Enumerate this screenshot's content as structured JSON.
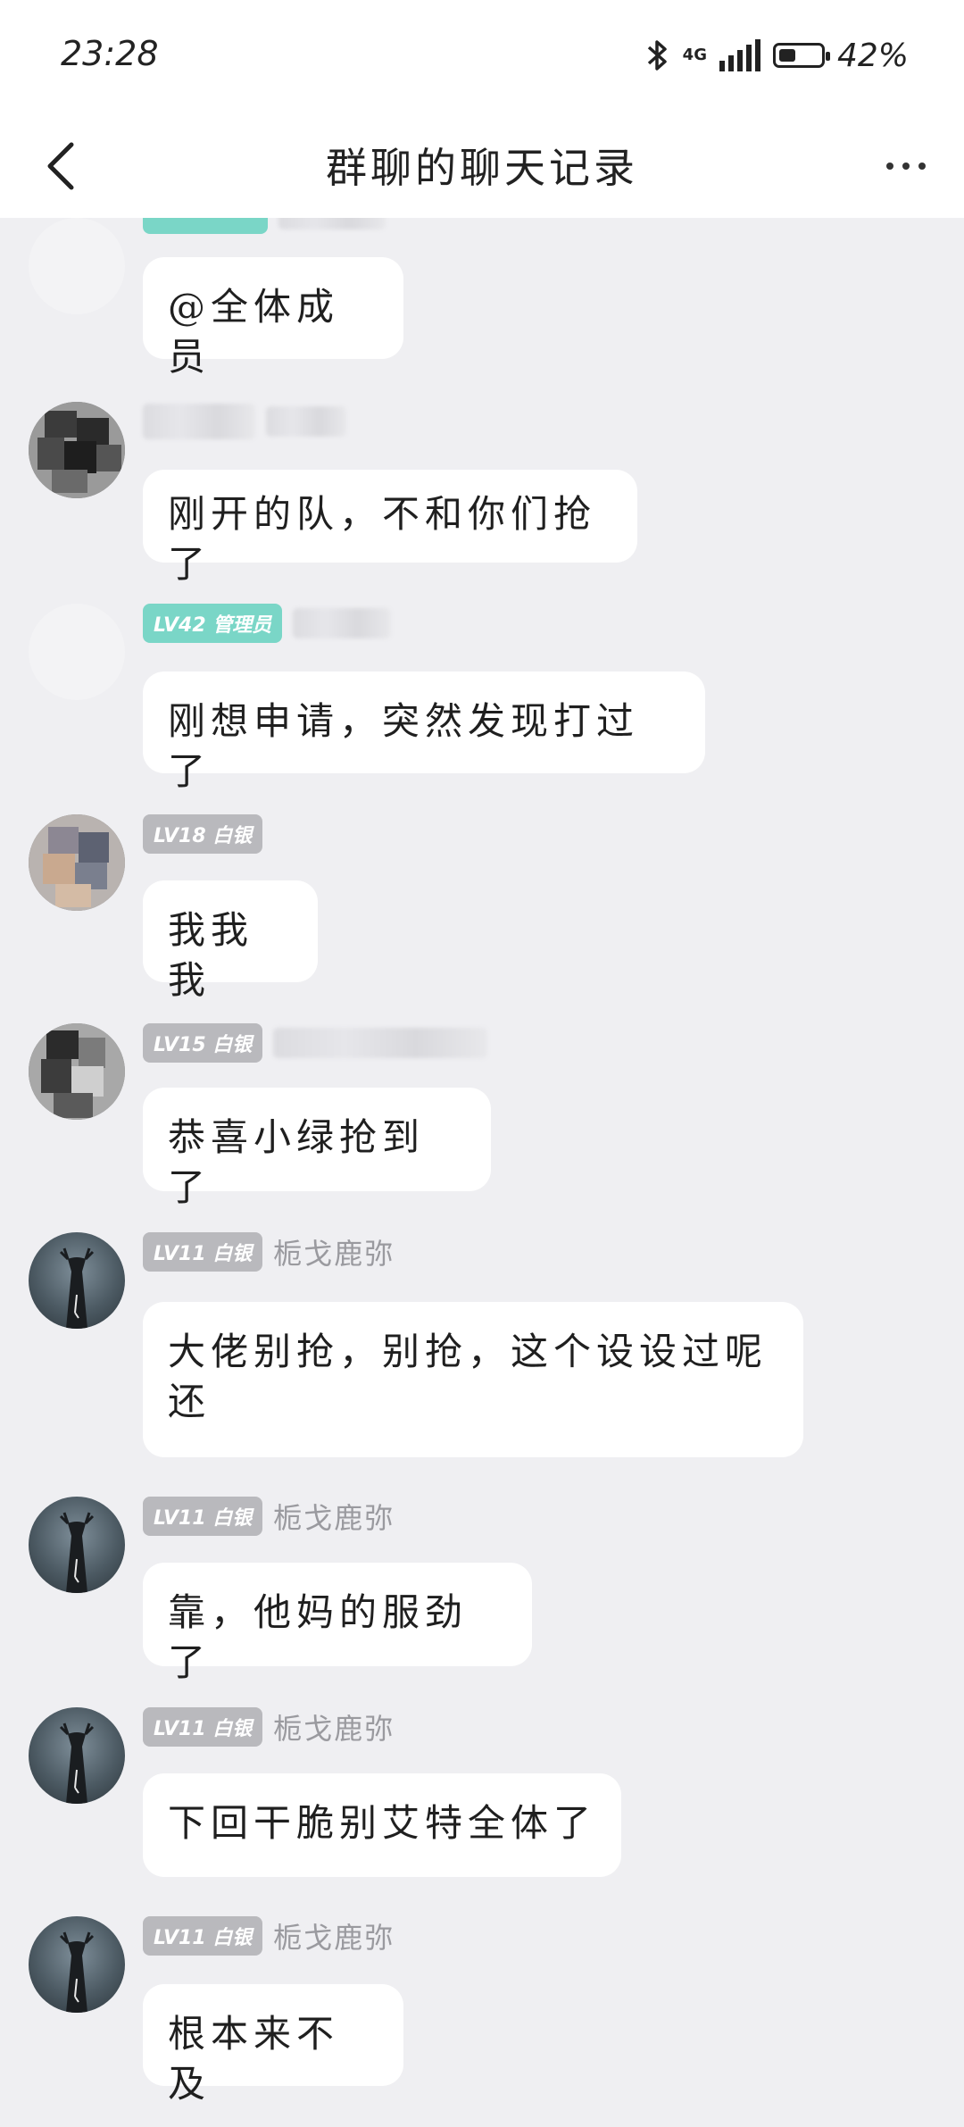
{
  "status_bar": {
    "time": "23:28",
    "network": "4G",
    "battery_level": 0.42,
    "battery_text": "42%"
  },
  "nav": {
    "title": "群聊的聊天记录"
  },
  "messages": [
    {
      "badge": "",
      "badge_style": "teal",
      "nick": "",
      "text": "@全体成员",
      "avatar": "blank"
    },
    {
      "badge": "",
      "badge_style": "none",
      "nick": "",
      "text": "刚开的队，不和你们抢了",
      "avatar": "mosaic"
    },
    {
      "badge": "LV42 管理员",
      "badge_style": "teal",
      "nick": "",
      "text": "刚想申请，突然发现打过了",
      "avatar": "blank"
    },
    {
      "badge": "LV18 白银",
      "badge_style": "gray",
      "nick": "",
      "text": "我我我",
      "avatar": "mosaic"
    },
    {
      "badge": "LV15 白银",
      "badge_style": "gray",
      "nick": "",
      "text": "恭喜小绿抢到了",
      "avatar": "mosaic"
    },
    {
      "badge": "LV11 白银",
      "badge_style": "gray",
      "nick": "栀戈鹿弥",
      "text": "大佬别抢，别抢，这个设设过呢还",
      "avatar": "deer"
    },
    {
      "badge": "LV11 白银",
      "badge_style": "gray",
      "nick": "栀戈鹿弥",
      "text": "靠，他妈的服劲了",
      "avatar": "deer"
    },
    {
      "badge": "LV11 白银",
      "badge_style": "gray",
      "nick": "栀戈鹿弥",
      "text": "下回干脆别艾特全体了",
      "avatar": "deer"
    },
    {
      "badge": "LV11 白银",
      "badge_style": "gray",
      "nick": "栀戈鹿弥",
      "text": "根本来不及",
      "avatar": "deer"
    }
  ]
}
